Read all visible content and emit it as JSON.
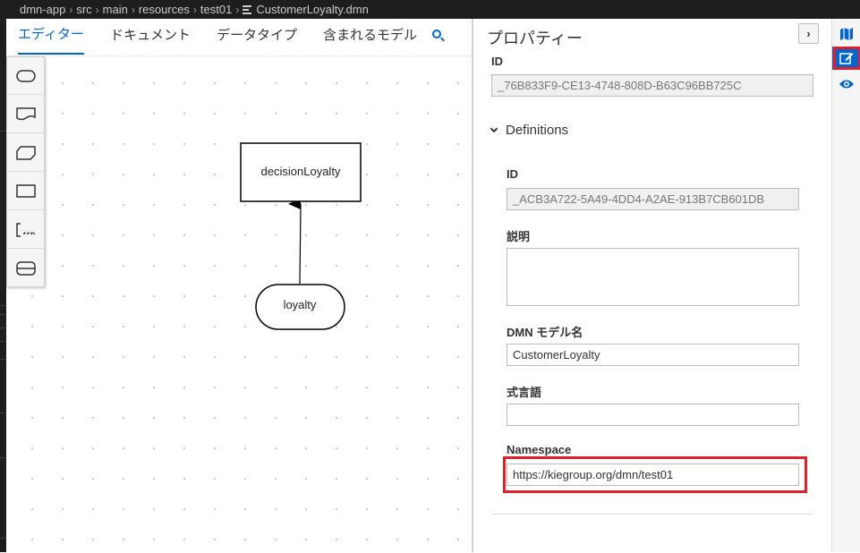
{
  "breadcrumb": {
    "items": [
      "dmn-app",
      "src",
      "main",
      "resources",
      "test01"
    ],
    "file": "CustomerLoyalty.dmn"
  },
  "editor": {
    "tabs": [
      "エディター",
      "ドキュメント",
      "データタイプ",
      "含まれるモデル"
    ],
    "active_tab": "エディター",
    "palette": [
      "decision-tool",
      "input-data-tool",
      "knowledge-source-tool",
      "business-knowledge-model-tool",
      "annotation-tool",
      "decision-service-tool"
    ]
  },
  "diagram": {
    "decision": "decisionLoyalty",
    "input": "loyalty"
  },
  "properties": {
    "title": "プロパティー",
    "id_label": "ID",
    "id_value": "_76B833F9-CE13-4748-808D-B63C96BB725C",
    "section": "Definitions",
    "def_id_label": "ID",
    "def_id_value": "_ACB3A722-5A49-4DD4-A2AE-913B7CB601DB",
    "description_label": "説明",
    "description_value": "",
    "model_name_label": "DMN モデル名",
    "model_name_value": "CustomerLoyalty",
    "expression_language_label": "式言語",
    "expression_language_value": "",
    "namespace_label": "Namespace",
    "namespace_value": "https://kiegroup.org/dmn/test01"
  },
  "colors": {
    "accent": "#0066cc",
    "highlight": "#e0202a"
  }
}
